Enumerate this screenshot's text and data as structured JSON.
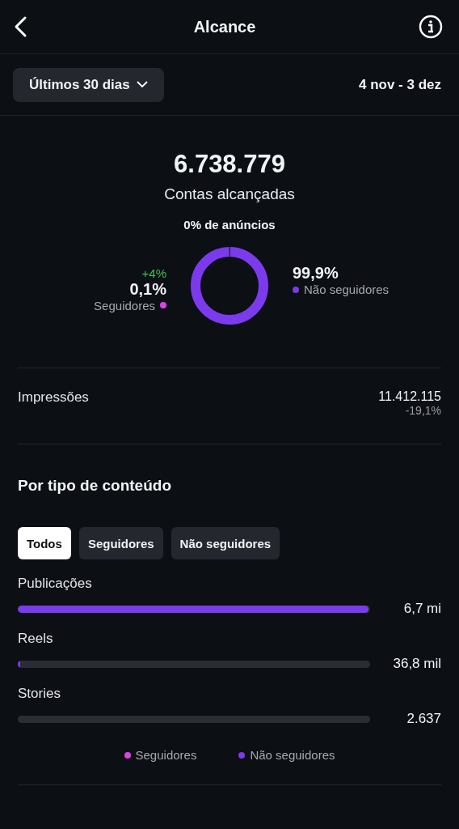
{
  "header": {
    "title": "Alcance"
  },
  "period": {
    "label": "Últimos 30 dias",
    "range": "4 nov - 3 dez"
  },
  "summary": {
    "total": "6.738.779",
    "caption": "Contas alcançadas",
    "ads": "0% de anúncios"
  },
  "segments": [
    {
      "label": "Seguidores",
      "percent": "0,1%",
      "change": "+4%",
      "color": "#e040e6"
    },
    {
      "label": "Não seguidores",
      "percent": "99,9%",
      "color": "#7c3aed"
    }
  ],
  "impressions": {
    "label": "Impressões",
    "value": "11.412.115",
    "change": "-19,1%"
  },
  "content": {
    "title": "Por tipo de conteúdo",
    "filters": [
      {
        "label": "Todos",
        "selected": true
      },
      {
        "label": "Seguidores",
        "selected": false
      },
      {
        "label": "Não seguidores",
        "selected": false
      }
    ],
    "rows": [
      {
        "label": "Publicações",
        "value": "6,7 mi",
        "level": 0.995
      },
      {
        "label": "Reels",
        "value": "36,8 mil",
        "level": 0.008
      },
      {
        "label": "Stories",
        "value": "2.637",
        "level": 0
      }
    ],
    "legend": [
      {
        "label": "Seguidores",
        "color": "#e040e6"
      },
      {
        "label": "Não seguidores",
        "color": "#7c3aed"
      }
    ]
  }
}
